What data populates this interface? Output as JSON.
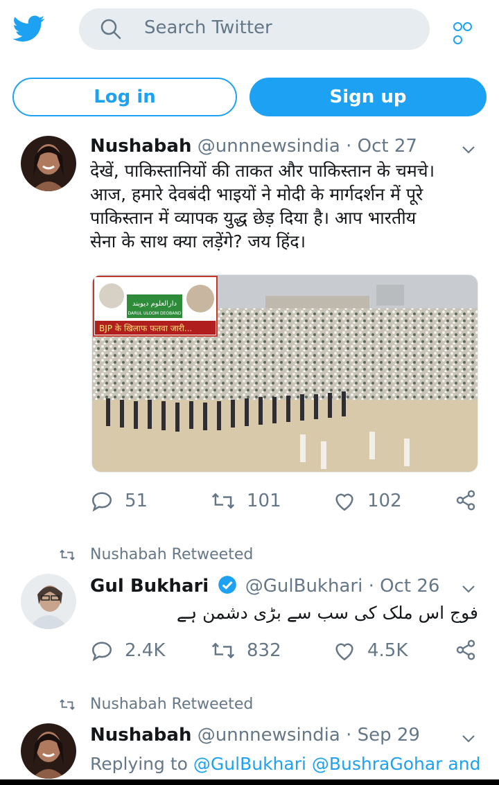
{
  "header": {
    "search_placeholder": "Search Twitter",
    "login_label": "Log in",
    "signup_label": "Sign up",
    "brand_color": "#1da1f2"
  },
  "tweets": [
    {
      "name": "Nushabah",
      "handle": "@unnnewsindia",
      "date": "· Oct 27",
      "text_lines": [
        "देखें, पाकिस्तानियों की ताकत और पाकिस्तान के चमचे।",
        "आज, हमारे देवबंदी भाइयों ने मोदी के मार्गदर्शन में पूरे",
        "पाकिस्तान में व्यापक युद्ध छेड़ दिया है। आप भारतीय",
        "सेना के साथ क्या लड़ेंगे? जय हिंद।"
      ],
      "media": {
        "inset_banner": "دارالعلوم دیوبند",
        "inset_sub": "DARUL ULOOM DEOBAND",
        "inset_caption": "BJP के खिलाफ फतवा जारी..."
      },
      "replies": "51",
      "retweets": "101",
      "likes": "102"
    },
    {
      "retweeted_by": "Nushabah Retweeted",
      "name": "Gul Bukhari",
      "handle": "@GulBukhari",
      "date": "· Oct 26",
      "text": "فوج اس ملک کی سب سے بڑی دشمن ہے",
      "replies": "2.4K",
      "retweets": "832",
      "likes": "4.5K"
    },
    {
      "retweeted_by": "Nushabah Retweeted",
      "name": "Nushabah",
      "handle": "@unnnewsindia",
      "date": "· Sep 29",
      "replying_prefix": "Replying to",
      "replying_to": "@GulBukhari @BushraGohar and"
    }
  ]
}
